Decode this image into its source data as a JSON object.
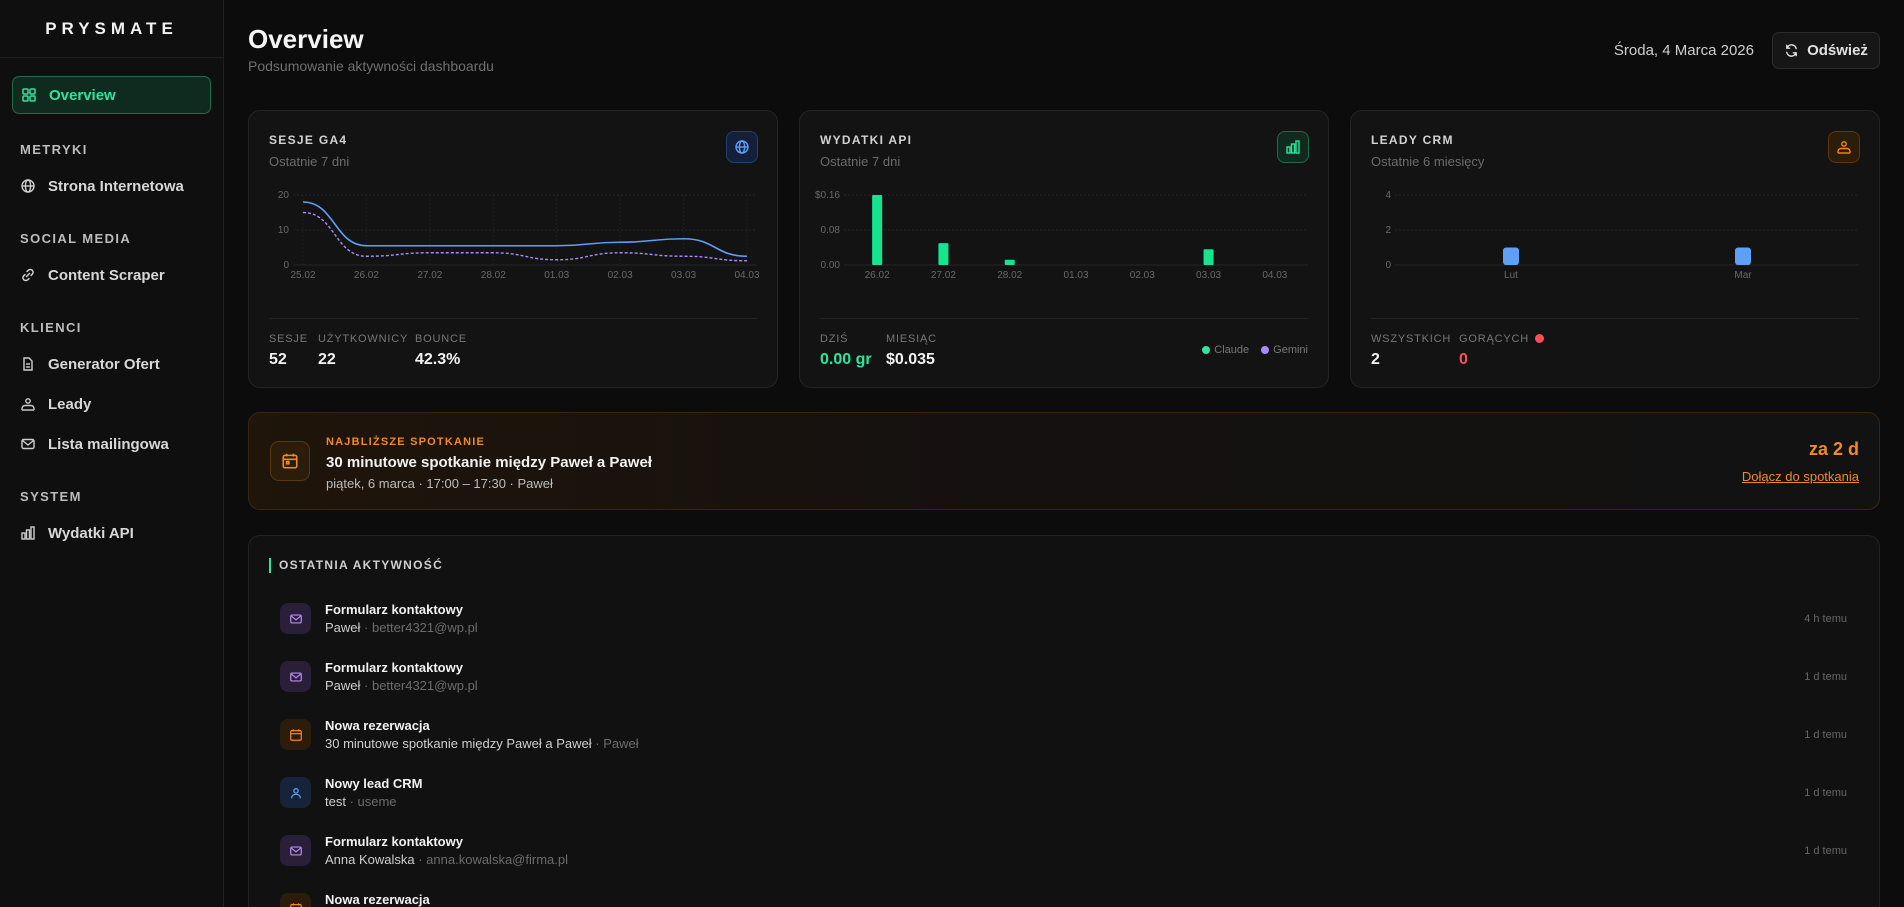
{
  "brand": "PRYSMATE",
  "sidebar": {
    "overview": "Overview",
    "sections": {
      "metryki": "METRYKI",
      "social": "SOCIAL MEDIA",
      "klienci": "KLIENCI",
      "system": "SYSTEM"
    },
    "items": {
      "strona": "Strona Internetowa",
      "scraper": "Content Scraper",
      "oferty": "Generator Ofert",
      "leady": "Leady",
      "mailing": "Lista mailingowa",
      "wydatki": "Wydatki API"
    }
  },
  "header": {
    "title": "Overview",
    "subtitle": "Podsumowanie aktywności dashboardu",
    "date": "Środa, 4 Marca 2026",
    "refresh_label": "Odśwież"
  },
  "colors": {
    "accent": "#2ee59d",
    "orange": "#f08a24",
    "blue": "#5ea0f5",
    "purple": "#b98af0",
    "red": "#ff4d5a"
  },
  "cards": {
    "ga4": {
      "title": "SESJE GA4",
      "subtitle": "Ostatnie 7 dni",
      "icon": "globe-icon",
      "stats": [
        {
          "label": "SESJE",
          "value": "52"
        },
        {
          "label": "UŻYTKOWNICY",
          "value": "22"
        },
        {
          "label": "BOUNCE",
          "value": "42.3%"
        }
      ]
    },
    "api": {
      "title": "WYDATKI API",
      "subtitle": "Ostatnie 7 dni",
      "icon": "bar-chart-icon",
      "stats": [
        {
          "label": "DZIŚ",
          "value": "0.00 gr"
        },
        {
          "label": "MIESIĄC",
          "value": "$0.035"
        }
      ],
      "legend": [
        "Claude",
        "Gemini"
      ]
    },
    "crm": {
      "title": "LEADY CRM",
      "subtitle": "Ostatnie 6 miesięcy",
      "icon": "users-icon",
      "stats": [
        {
          "label": "WSZYSTKICH",
          "value": "2"
        },
        {
          "label": "GORĄCYCH",
          "value": "0"
        }
      ]
    }
  },
  "chart_data": [
    {
      "type": "line",
      "x": [
        "25.02",
        "26.02",
        "27.02",
        "28.02",
        "01.03",
        "02.03",
        "03.03",
        "04.03"
      ],
      "ylim": [
        0,
        20
      ],
      "yticks": [
        "0",
        "10",
        "20"
      ],
      "series": [
        {
          "values": [
            18,
            5.5,
            5.5,
            5.5,
            5.5,
            6.5,
            7.5,
            2.5
          ]
        },
        {
          "values": [
            15,
            2.5,
            3.5,
            3.5,
            1.5,
            3.5,
            2.5,
            1.2
          ]
        }
      ],
      "grid": true
    },
    {
      "type": "bar",
      "categories": [
        "26.02",
        "27.02",
        "28.02",
        "01.03",
        "02.03",
        "03.03",
        "04.03"
      ],
      "ylim": [
        0,
        0.16
      ],
      "yticks": [
        "0.00",
        "0.08",
        "$0.16"
      ],
      "series": [
        {
          "name": "Claude",
          "values": [
            0.16,
            0.05,
            0.012,
            0,
            0,
            0.036,
            0
          ]
        },
        {
          "name": "Gemini",
          "values": [
            0,
            0,
            0,
            0,
            0,
            0,
            0
          ]
        }
      ],
      "grid": true
    },
    {
      "type": "bar",
      "categories": [
        "Lut",
        "Mar"
      ],
      "ylim": [
        0,
        4
      ],
      "yticks": [
        "0",
        "2",
        "4"
      ],
      "values": [
        1,
        1
      ],
      "grid": true
    }
  ],
  "meeting": {
    "kicker": "NAJBLIŻSZE SPOTKANIE",
    "title": "30 minutowe spotkanie między Paweł a Paweł",
    "meta": "piątek, 6 marca · 17:00 – 17:30 · Paweł",
    "when": "za 2 d",
    "join": "Dołącz do spotkania"
  },
  "activity": {
    "title": "OSTATNIA AKTYWNOŚĆ",
    "items": [
      {
        "icon": "mail-icon",
        "kind": "mail",
        "title": "Formularz kontaktowy",
        "main": "Paweł",
        "extra": " · better4321@wp.pl",
        "time": "4 h temu"
      },
      {
        "icon": "mail-icon",
        "kind": "mail",
        "title": "Formularz kontaktowy",
        "main": "Paweł",
        "extra": " · better4321@wp.pl",
        "time": "1 d temu"
      },
      {
        "icon": "calendar-icon",
        "kind": "cal",
        "title": "Nowa rezerwacja",
        "main": "30 minutowe spotkanie między Paweł a Paweł",
        "extra": " · Paweł",
        "time": "1 d temu"
      },
      {
        "icon": "user-icon",
        "kind": "user",
        "title": "Nowy lead CRM",
        "main": "test",
        "extra": " · useme",
        "time": "1 d temu"
      },
      {
        "icon": "mail-icon",
        "kind": "mail",
        "title": "Formularz kontaktowy",
        "main": "Anna Kowalska",
        "extra": " · anna.kowalska@firma.pl",
        "time": "1 d temu"
      },
      {
        "icon": "calendar-icon",
        "kind": "cal",
        "title": "Nowa rezerwacja",
        "main": "",
        "extra": "",
        "time": ""
      }
    ]
  }
}
